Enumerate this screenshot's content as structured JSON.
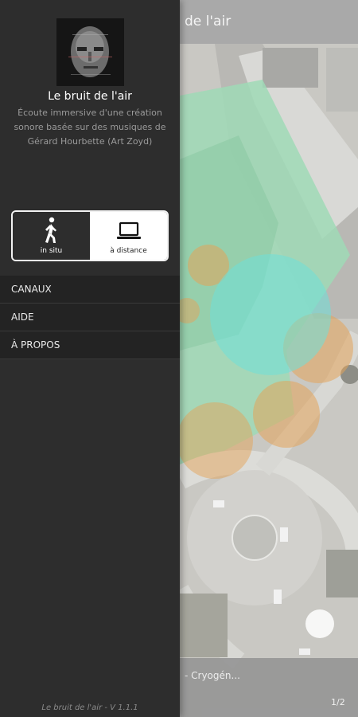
{
  "app": {
    "title": "Le bruit de l'air",
    "description": "Écoute immersive d'une création sonore basée sur des musiques de Gérard Hourbette (Art Zoyd)",
    "version": "Le bruit de l'air - V 1.1.1"
  },
  "map": {
    "title_partial": "de l'air",
    "track_partial": "- Cryogén...",
    "playlist_count": "1/2",
    "icons": [
      "list-icon",
      "sound-waves-icon",
      "playlist-icon"
    ]
  },
  "mode": {
    "insitu_label": "in situ",
    "distance_label": "à distance",
    "selected": "à distance",
    "icons": [
      "walking-person-icon",
      "laptop-icon"
    ]
  },
  "menu": {
    "items": [
      {
        "label": "CANAUX"
      },
      {
        "label": "AIDE"
      },
      {
        "label": "À PROPOS"
      }
    ]
  },
  "colors": {
    "drawer_bg": "#2d2d2d",
    "menu_bg": "#232323",
    "zone_green": "#8fd3b0",
    "zone_orange": "#e4a45a",
    "zone_cyan": "#6fe0d8"
  }
}
